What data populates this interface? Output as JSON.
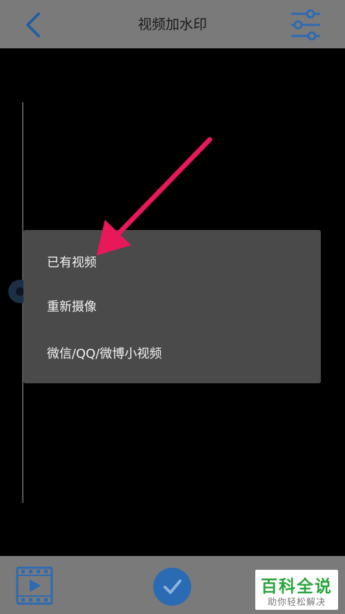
{
  "header": {
    "title": "视频加水印",
    "back_icon": "chevron-left-icon",
    "settings_icon": "sliders-icon"
  },
  "menu": {
    "items": [
      {
        "label": "已有视频"
      },
      {
        "label": "重新摄像"
      },
      {
        "label": "微信/QQ/微博小视频"
      }
    ]
  },
  "annotation": {
    "type": "arrow",
    "color": "#e8185a"
  },
  "footer": {
    "media_icon": "film-play-icon",
    "confirm_icon": "check-icon",
    "accent_color": "#2a6bb4"
  },
  "watermark": {
    "main": "百科全说",
    "sub": "助你轻松解决"
  }
}
